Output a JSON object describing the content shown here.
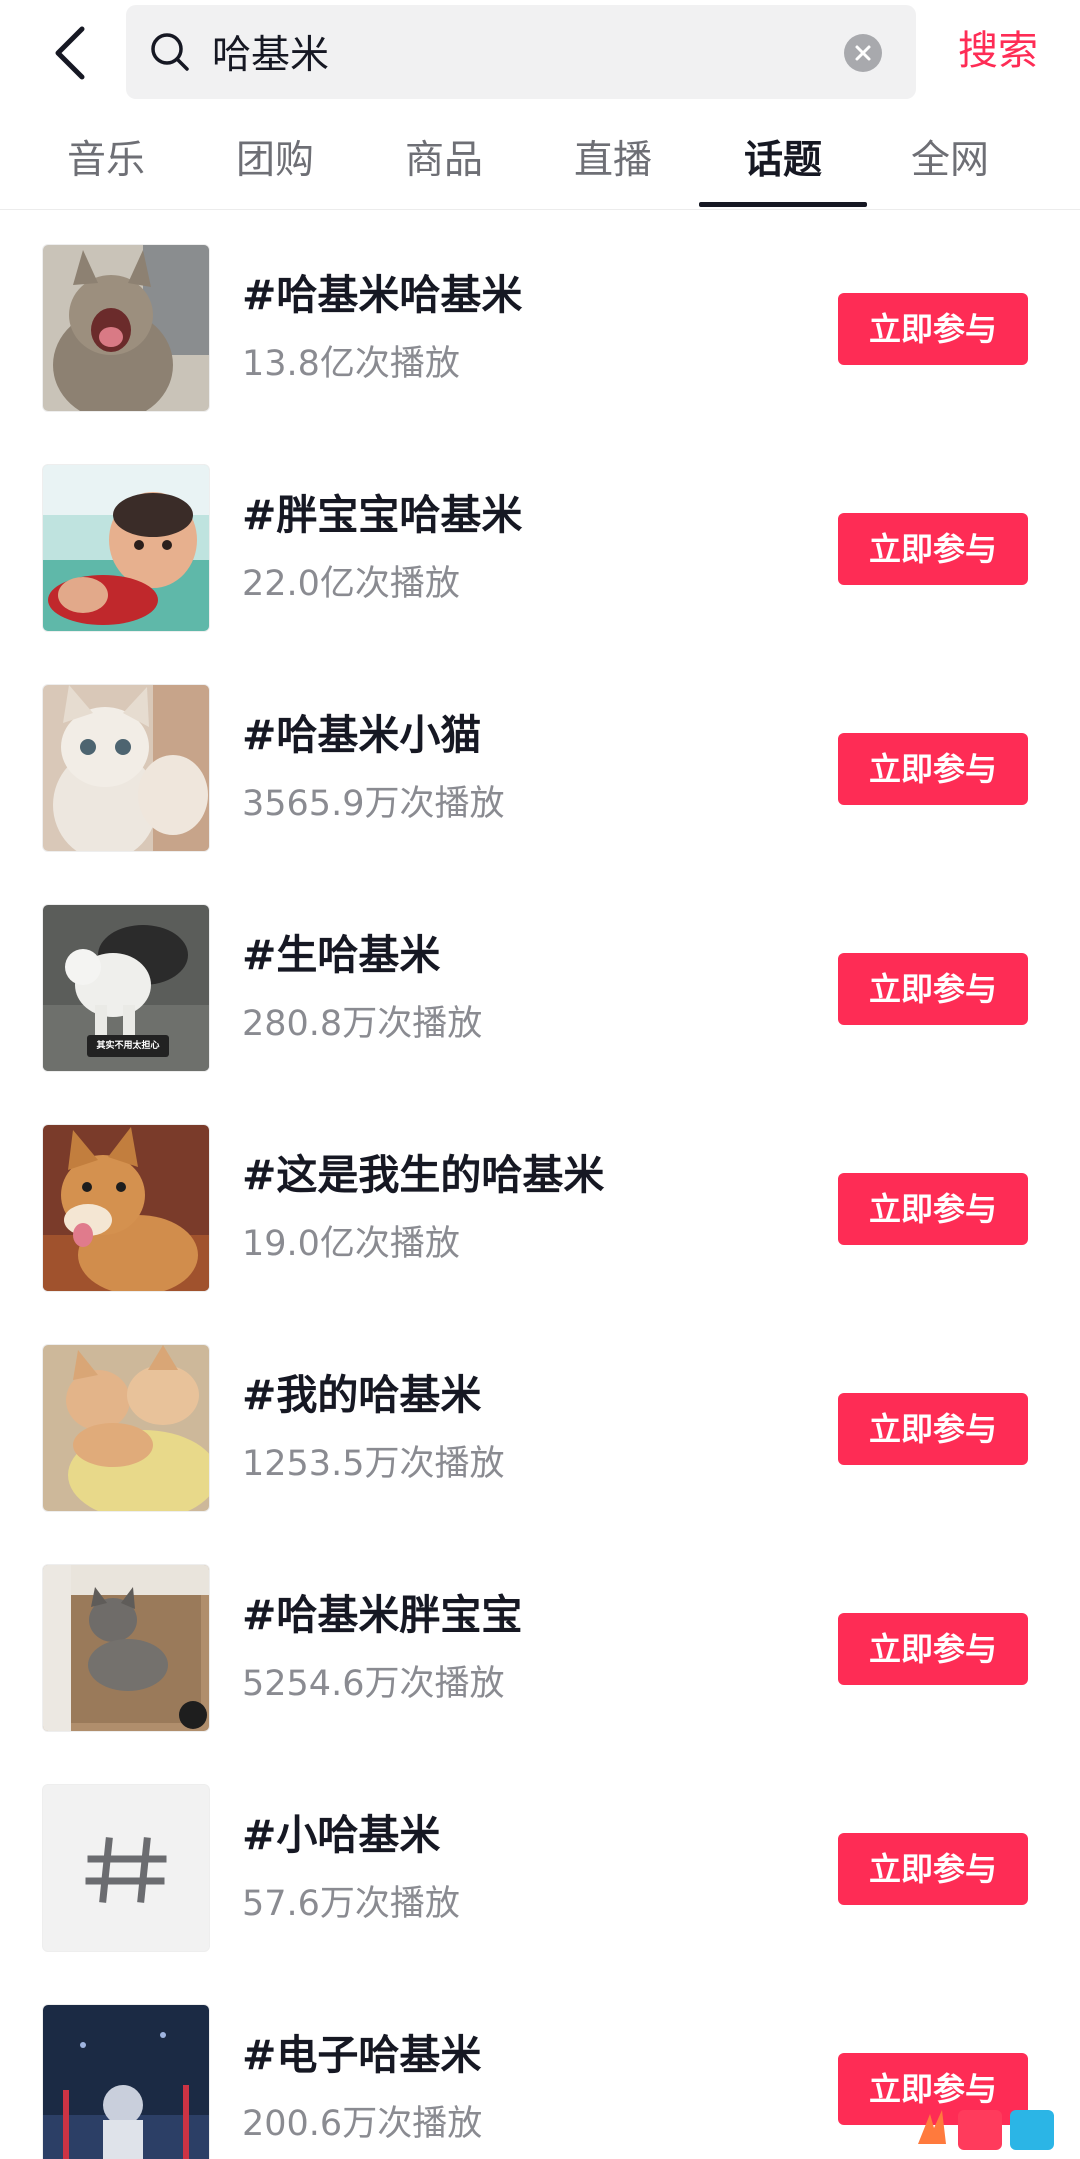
{
  "header": {
    "search_query": "哈基米",
    "search_button": "搜索"
  },
  "tabs": [
    {
      "label": "音乐",
      "active": false
    },
    {
      "label": "团购",
      "active": false
    },
    {
      "label": "商品",
      "active": false
    },
    {
      "label": "直播",
      "active": false
    },
    {
      "label": "话题",
      "active": true
    },
    {
      "label": "全网",
      "active": false
    }
  ],
  "topics": [
    {
      "title": "#哈基米哈基米",
      "plays": "13.8亿次播放",
      "button": "立即参与",
      "thumb": "yawning-cat-image"
    },
    {
      "title": "#胖宝宝哈基米",
      "plays": "22.0亿次播放",
      "button": "立即参与",
      "thumb": "baby-image"
    },
    {
      "title": "#哈基米小猫",
      "plays": "3565.9万次播放",
      "button": "立即参与",
      "thumb": "white-kitten-image"
    },
    {
      "title": "#生哈基米",
      "plays": "280.8万次播放",
      "button": "立即参与",
      "thumb": "white-cat-image",
      "caption": "其实不用太担心"
    },
    {
      "title": "#这是我生的哈基米",
      "plays": "19.0亿次播放",
      "button": "立即参与",
      "thumb": "shiba-dog-image"
    },
    {
      "title": "#我的哈基米",
      "plays": "1253.5万次播放",
      "button": "立即参与",
      "thumb": "orange-kittens-image"
    },
    {
      "title": "#哈基米胖宝宝",
      "plays": "5254.6万次播放",
      "button": "立即参与",
      "thumb": "tabby-kitten-image"
    },
    {
      "title": "#小哈基米",
      "plays": "57.6万次播放",
      "button": "立即参与",
      "thumb": "hashtag-placeholder"
    },
    {
      "title": "#电子哈基米",
      "plays": "200.6万次播放",
      "button": "立即参与",
      "thumb": "stage-person-image"
    }
  ],
  "colors": {
    "accent": "#fe2c55",
    "text_primary": "#161823",
    "text_secondary": "#8a8b91"
  }
}
